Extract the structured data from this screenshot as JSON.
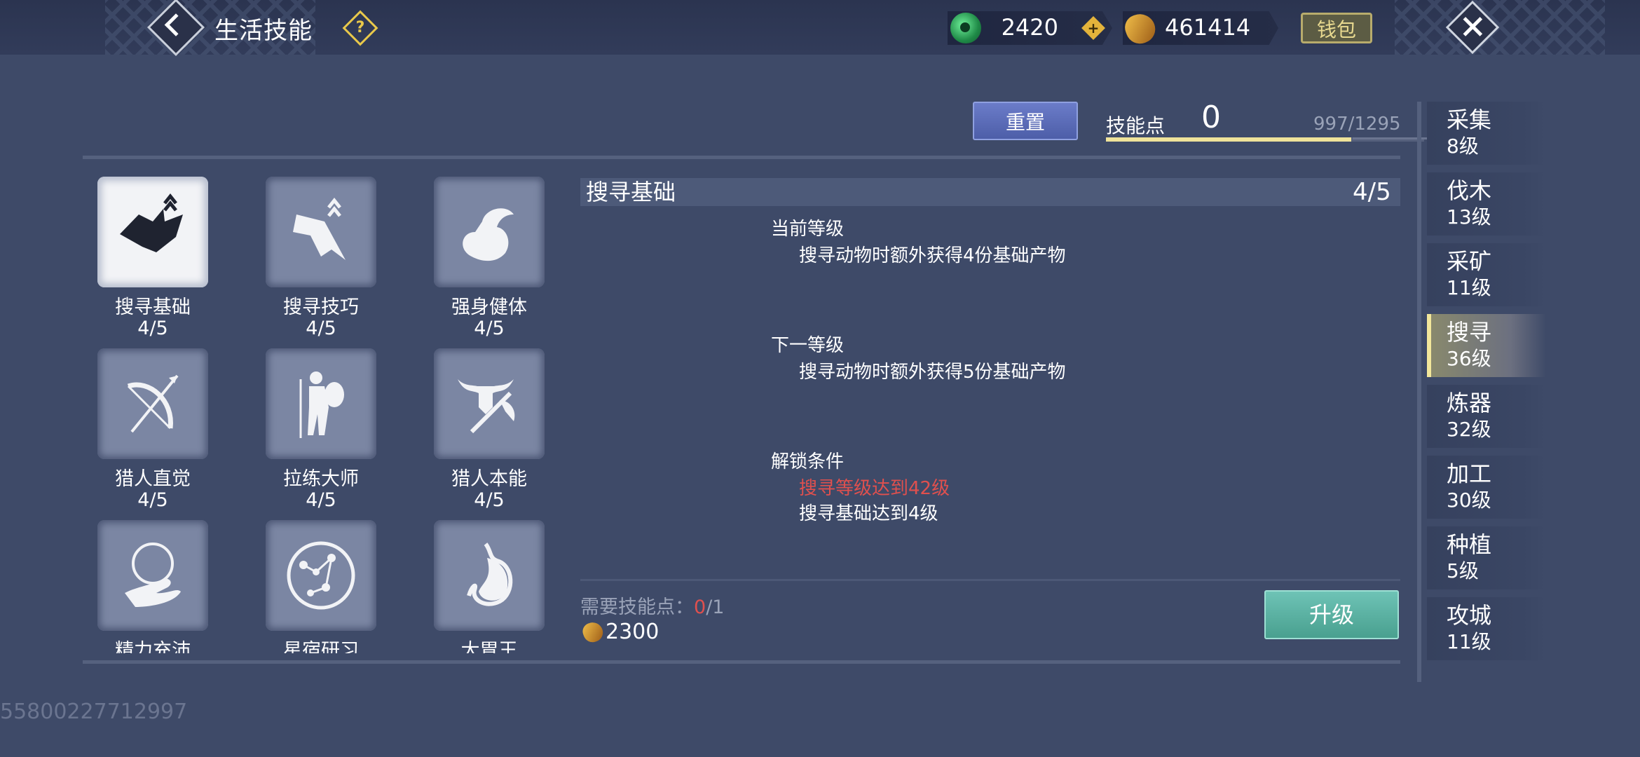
{
  "header": {
    "title": "生活技能",
    "help_symbol": "?",
    "jade_amount": "2420",
    "coin_amount": "461414",
    "wallet_label": "钱包",
    "plus_symbol": "+"
  },
  "skill_points": {
    "reset_label": "重置",
    "label": "技能点",
    "value": "0",
    "progress_text": "997/1295",
    "progress_fraction": 0.77
  },
  "skills": [
    {
      "name": "搜寻基础",
      "level": "4/5",
      "icon": "wolf-head-icon",
      "selected": true
    },
    {
      "name": "搜寻技巧",
      "level": "4/5",
      "icon": "banner-rank-icon",
      "selected": false
    },
    {
      "name": "强身健体",
      "level": "4/5",
      "icon": "muscle-arm-icon",
      "selected": false
    },
    {
      "name": "猎人直觉",
      "level": "4/5",
      "icon": "bow-arrow-icon",
      "selected": false
    },
    {
      "name": "拉练大师",
      "level": "4/5",
      "icon": "traveler-icon",
      "selected": false
    },
    {
      "name": "猎人本能",
      "level": "4/5",
      "icon": "skull-axe-icon",
      "selected": false
    },
    {
      "name": "精力充沛",
      "level": "",
      "icon": "hand-orb-icon",
      "selected": false
    },
    {
      "name": "星宿研习",
      "level": "",
      "icon": "constellation-icon",
      "selected": false
    },
    {
      "name": "大胃王",
      "level": "",
      "icon": "stomach-icon",
      "selected": false
    }
  ],
  "detail": {
    "name": "搜寻基础",
    "level": "4/5",
    "current_title": "当前等级",
    "current_text": "搜寻动物时额外获得4份基础产物",
    "next_title": "下一等级",
    "next_text": "搜寻动物时额外获得5份基础产物",
    "unlock_title": "解锁条件",
    "unlock_req_1": "搜寻等级达到42级",
    "unlock_req_2": "搜寻基础达到4级",
    "need_label": "需要技能点：",
    "need_have": "0",
    "need_sep": "/1",
    "cost": "2300",
    "upgrade_label": "升级"
  },
  "tabs": [
    {
      "name": "采集",
      "level": "8级",
      "active": false
    },
    {
      "name": "伐木",
      "level": "13级",
      "active": false
    },
    {
      "name": "采矿",
      "level": "11级",
      "active": false
    },
    {
      "name": "搜寻",
      "level": "36级",
      "active": true
    },
    {
      "name": "炼器",
      "level": "32级",
      "active": false
    },
    {
      "name": "加工",
      "level": "30级",
      "active": false
    },
    {
      "name": "种植",
      "level": "5级",
      "active": false
    },
    {
      "name": "攻城",
      "level": "11级",
      "active": false
    }
  ],
  "uid": "55800227712997",
  "colors": {
    "background": "#3e4a68",
    "accent_gold": "#e8c84a",
    "warning_red": "#e0504e",
    "upgrade_teal": "#49a08f",
    "reset_blue": "#5a6bb8"
  }
}
